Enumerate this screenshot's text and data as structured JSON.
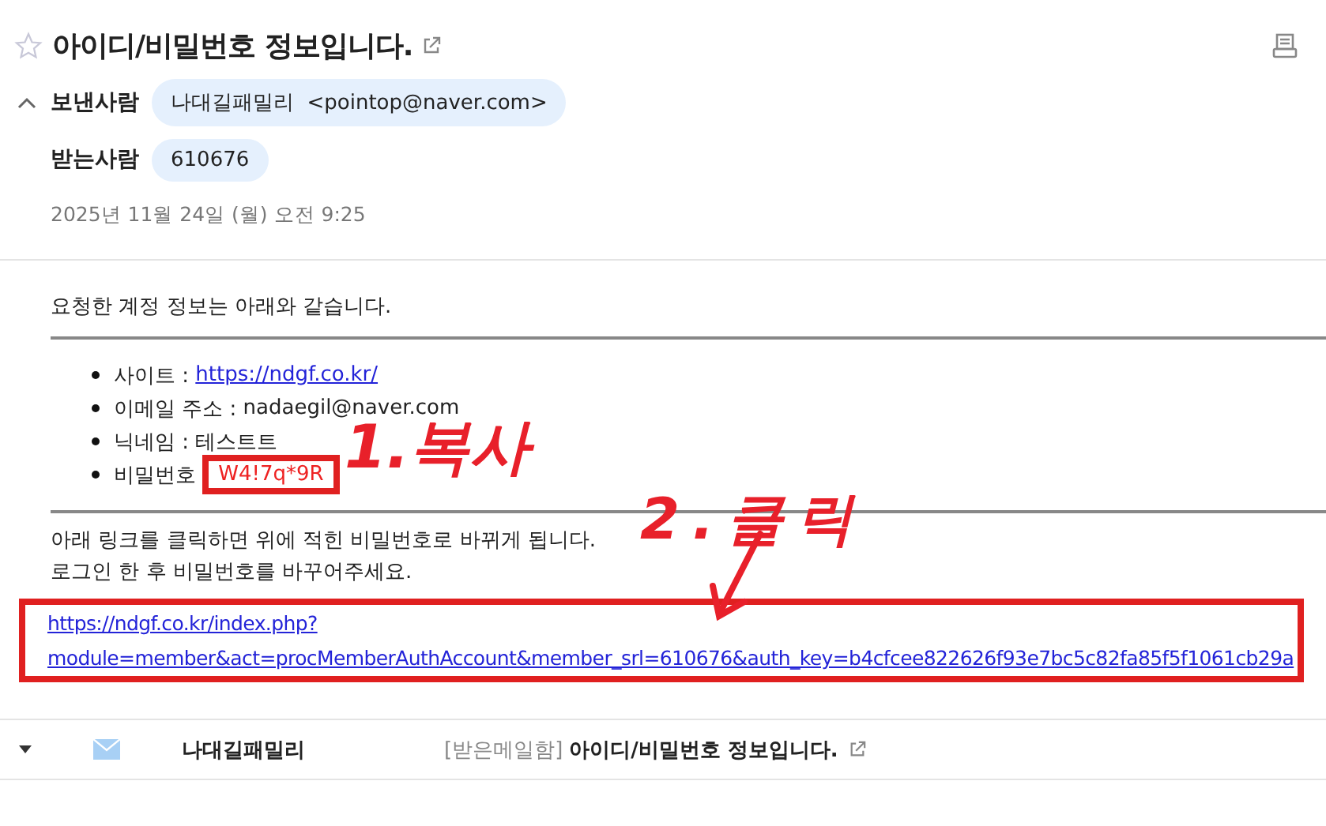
{
  "mail": {
    "title": "아이디/비밀번호 정보입니다.",
    "starred": false,
    "sender_label": "보낸사람",
    "sender_name": "나대길패밀리",
    "sender_email": "<pointop@naver.com>",
    "recipient_label": "받는사람",
    "recipient": "610676",
    "date": "2025년 11월 24일 (월) 오전 9:25"
  },
  "body": {
    "intro": "요청한 계정 정보는 아래와 같습니다.",
    "items": [
      {
        "label": "사이트 : ",
        "value": "https://ndgf.co.kr/",
        "kind": "link"
      },
      {
        "label": "이메일 주소 : ",
        "value": "nadaegil@naver.com",
        "kind": "text"
      },
      {
        "label": "닉네임 : ",
        "value": "테스트트",
        "kind": "text"
      },
      {
        "label": "비밀번호 ",
        "value": "W4!7q*9R",
        "kind": "password",
        "highlighted": true
      }
    ],
    "notes": [
      "아래 링크를 클릭하면 위에 적힌 비밀번호로 바뀌게 됩니다.",
      "로그인 한 후 비밀번호를 바꾸어주세요."
    ],
    "link_lines": [
      "https://ndgf.co.kr/index.php?",
      "module=member&act=procMemberAuthAccount&member_srl=610676&auth_key=b4cfcee822626f93e7bc5c82fa85f5f1061cb29a"
    ],
    "link_highlighted": true
  },
  "annotations": [
    {
      "text": "1.복사"
    },
    {
      "text": "2.클릭"
    }
  ],
  "list_row": {
    "sender": "나대길패밀리",
    "folder": "[받은메일함]",
    "subject": "아이디/비밀번호 정보입니다."
  }
}
